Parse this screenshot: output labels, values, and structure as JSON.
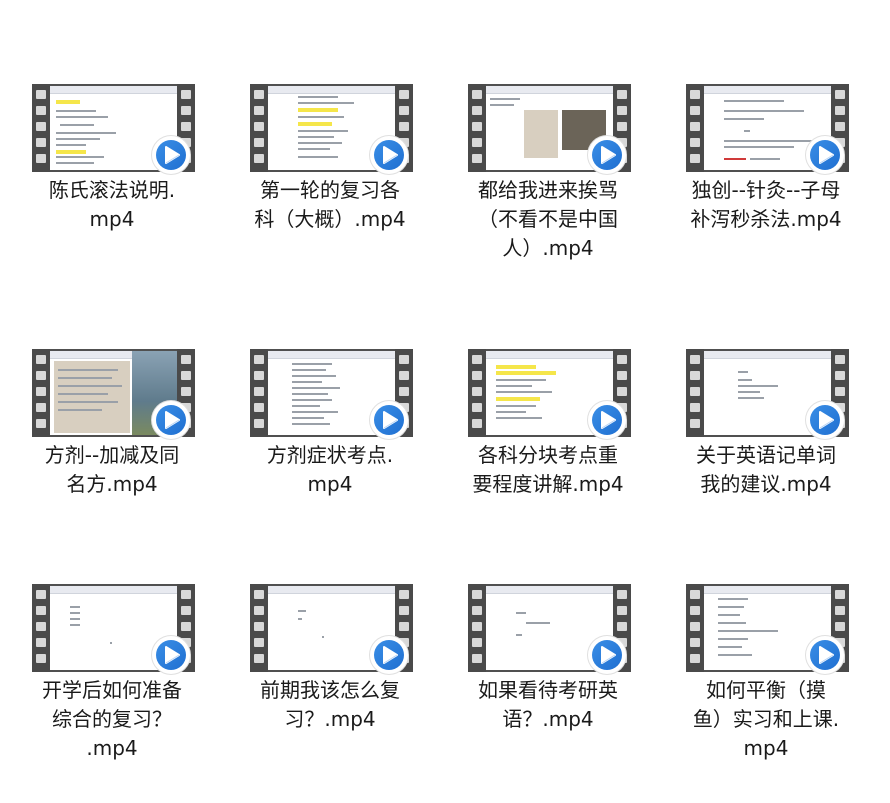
{
  "window": {
    "view": "large-icons"
  },
  "files": [
    {
      "name_lines": [
        "陈氏滚法说明.",
        "mp4"
      ],
      "thumb": "doc-yellow"
    },
    {
      "name_lines": [
        "第一轮的复习各",
        "科（大概）.mp4"
      ],
      "thumb": "doc-list"
    },
    {
      "name_lines": [
        "都给我进来挨骂",
        "（不看不是中国",
        "人）.mp4"
      ],
      "thumb": "photos"
    },
    {
      "name_lines": [
        "独创--针灸--子母",
        "补泻秒杀法.mp4"
      ],
      "thumb": "doc-spaced"
    },
    {
      "name_lines": [
        "方剂--加减及同",
        "名方.mp4"
      ],
      "thumb": "handwritten"
    },
    {
      "name_lines": [
        "方剂症状考点.",
        "mp4"
      ],
      "thumb": "doc-list2"
    },
    {
      "name_lines": [
        "各科分块考点重",
        "要程度讲解.mp4"
      ],
      "thumb": "doc-yellow2"
    },
    {
      "name_lines": [
        "关于英语记单词",
        "我的建议.mp4"
      ],
      "thumb": "doc-sparse"
    },
    {
      "name_lines": [
        "开学后如何准备",
        "综合的复习？",
        ".mp4"
      ],
      "thumb": "doc-blank"
    },
    {
      "name_lines": [
        "前期我该怎么复",
        "习？.mp4"
      ],
      "thumb": "doc-blank2"
    },
    {
      "name_lines": [
        "如果看待考研英",
        "语？.mp4"
      ],
      "thumb": "doc-blank3"
    },
    {
      "name_lines": [
        "如何平衡（摸",
        "鱼）实习和上课.",
        "mp4"
      ],
      "thumb": "doc-hand-list"
    }
  ],
  "icons": {
    "play_badge": "play-arrow-icon",
    "accent": "#3a8ee6",
    "accent_dark": "#1f6fd1"
  }
}
